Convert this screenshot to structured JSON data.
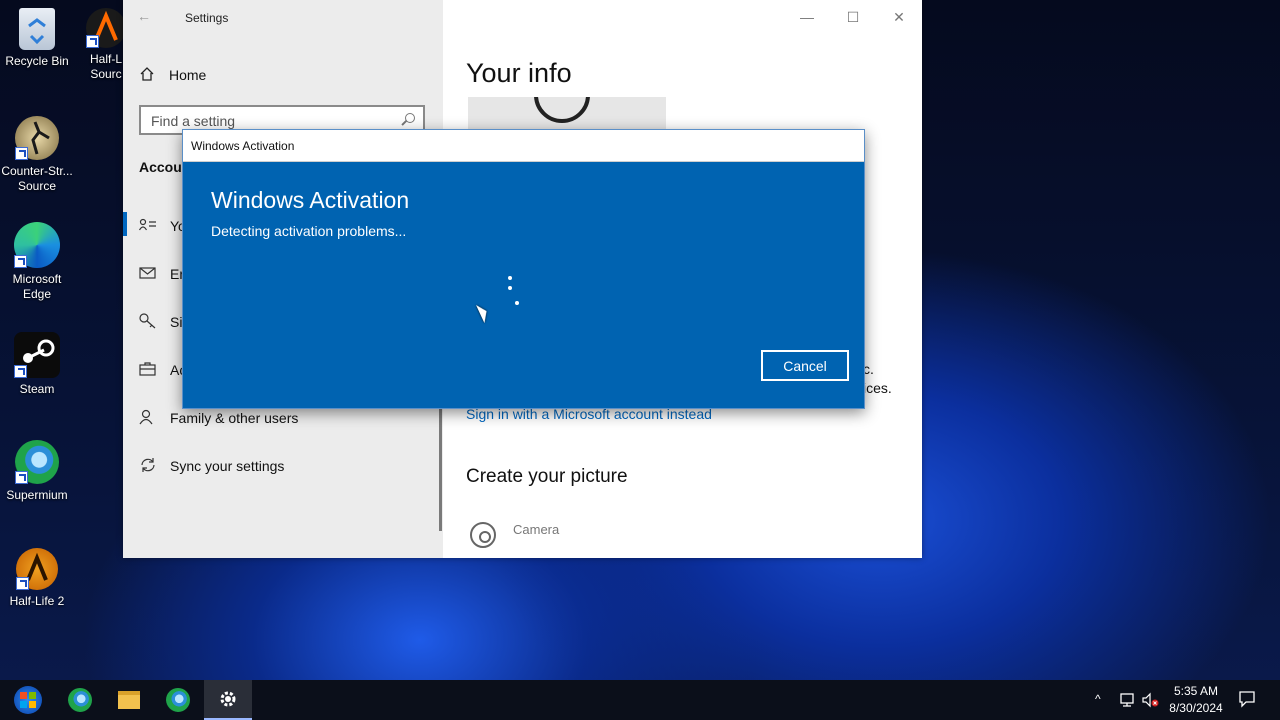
{
  "desktop": {
    "icons": [
      {
        "label_1": "Recycle Bin",
        "label_2": ""
      },
      {
        "label_1": "Half-L",
        "label_2": "Sourc"
      },
      {
        "label_1": "Counter-Str...",
        "label_2": "Source"
      },
      {
        "label_1": "Microsoft",
        "label_2": "Edge"
      },
      {
        "label_1": "Steam",
        "label_2": ""
      },
      {
        "label_1": "Supermium",
        "label_2": ""
      },
      {
        "label_1": "Half-Life 2",
        "label_2": ""
      }
    ]
  },
  "settings": {
    "title": "Settings",
    "back_icon": "←",
    "controls": {
      "minimize": "—",
      "maximize": "☐",
      "close": "✕"
    },
    "home_label": "Home",
    "search_placeholder": "Find a setting",
    "section_title": "Accou",
    "nav": [
      {
        "label": "Yo",
        "icon": "person-card-icon"
      },
      {
        "label": "En",
        "icon": "mail-icon"
      },
      {
        "label": "Si",
        "icon": "key-icon"
      },
      {
        "label": "Ac",
        "icon": "briefcase-icon"
      },
      {
        "label": "Family & other users",
        "icon": "person-add-icon"
      },
      {
        "label": "Sync your settings",
        "icon": "sync-icon"
      }
    ],
    "main": {
      "heading": "Your info",
      "partial_1": "c.",
      "partial_2": "ices.",
      "ms_link": "Sign in with a Microsoft account instead",
      "create_picture": "Create your picture",
      "camera_label": "Camera"
    }
  },
  "dialog": {
    "window_title": "Windows Activation",
    "heading": "Windows Activation",
    "status": "Detecting activation problems...",
    "cancel_label": "Cancel"
  },
  "taskbar": {
    "time": "5:35 AM",
    "date": "8/30/2024",
    "tray_chevron": "^"
  },
  "colors": {
    "dialog_blue": "#0063b1",
    "link_blue": "#0067c0"
  }
}
